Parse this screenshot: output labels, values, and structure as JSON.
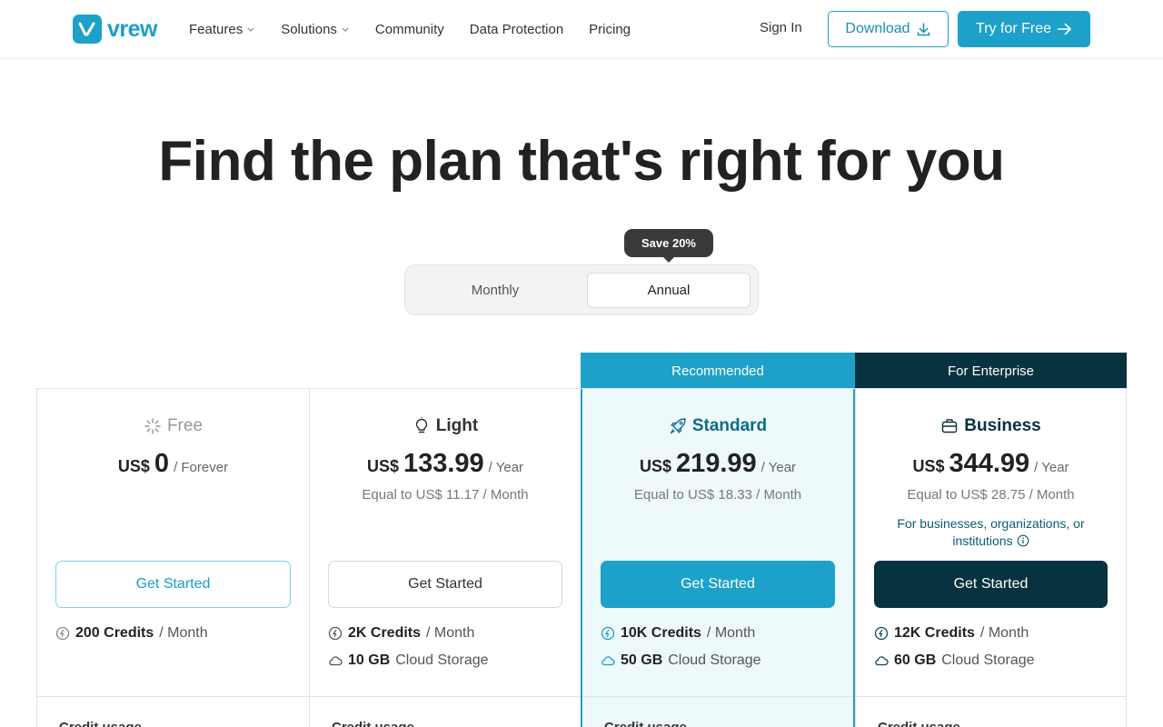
{
  "header": {
    "logo_text": "vrew",
    "nav": [
      {
        "label": "Features",
        "has_dropdown": true
      },
      {
        "label": "Solutions",
        "has_dropdown": true
      },
      {
        "label": "Community",
        "has_dropdown": false
      },
      {
        "label": "Data Protection",
        "has_dropdown": false
      },
      {
        "label": "Pricing",
        "has_dropdown": false
      }
    ],
    "sign_in": "Sign In",
    "download": "Download",
    "try_free": "Try for Free",
    "icons": {
      "download": "download-icon",
      "try": "arrow-right-icon"
    }
  },
  "hero": {
    "title": "Find the plan that's right for you"
  },
  "billing_toggle": {
    "badge": "Save 20%",
    "monthly": "Monthly",
    "annual": "Annual",
    "selected": "annual"
  },
  "tags": {
    "recommended": "Recommended",
    "enterprise": "For Enterprise"
  },
  "plans": [
    {
      "name": "Free",
      "icon": "sparkle-icon",
      "currency": "US$",
      "amount": "0",
      "period": "/ Forever",
      "equal": "",
      "button": "Get Started",
      "credits_value": "200 Credits",
      "credits_unit": "/ Month",
      "storage_value": "",
      "storage_unit": "",
      "usage_label": "Credit usage"
    },
    {
      "name": "Light",
      "icon": "lightbulb-icon",
      "currency": "US$",
      "amount": "133.99",
      "period": "/ Year",
      "equal": "Equal to US$ 11.17 / Month",
      "button": "Get Started",
      "credits_value": "2K Credits",
      "credits_unit": "/ Month",
      "storage_value": "10 GB",
      "storage_unit": "Cloud Storage",
      "usage_label": "Credit usage"
    },
    {
      "name": "Standard",
      "icon": "rocket-icon",
      "currency": "US$",
      "amount": "219.99",
      "period": "/ Year",
      "equal": "Equal to US$ 18.33 / Month",
      "button": "Get Started",
      "credits_value": "10K Credits",
      "credits_unit": "/ Month",
      "storage_value": "50 GB",
      "storage_unit": "Cloud Storage",
      "usage_label": "Credit usage"
    },
    {
      "name": "Business",
      "icon": "briefcase-icon",
      "currency": "US$",
      "amount": "344.99",
      "period": "/ Year",
      "equal": "Equal to US$ 28.75 / Month",
      "note": "For businesses, organizations, or institutions",
      "button": "Get Started",
      "credits_value": "12K Credits",
      "credits_unit": "/ Month",
      "storage_value": "60 GB",
      "storage_unit": "Cloud Storage",
      "usage_label": "Credit usage"
    }
  ],
  "colors": {
    "brand": "#1da1c9",
    "enterprise": "#07323f",
    "standard_bg": "#eef9fc"
  }
}
